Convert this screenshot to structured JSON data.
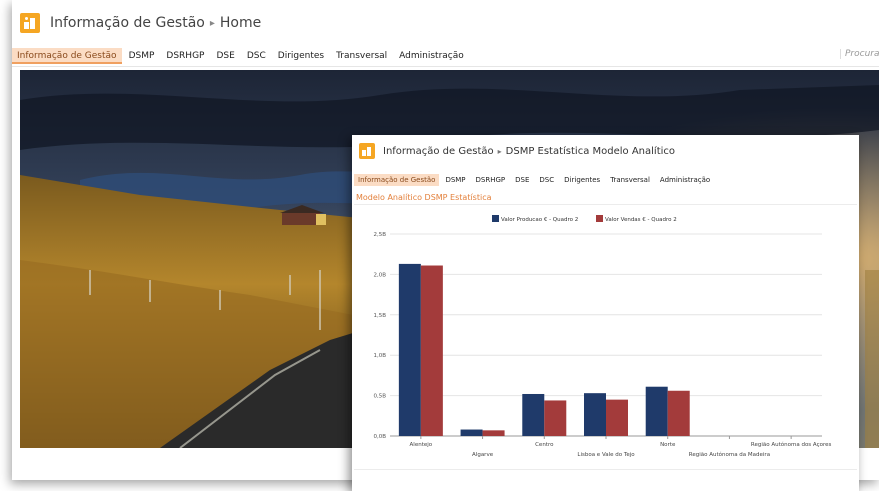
{
  "header": {
    "title": "Informação de Gestão",
    "separator": "▸",
    "page": "Home"
  },
  "nav": {
    "items": [
      {
        "label": "Informação de Gestão",
        "active": true
      },
      {
        "label": "DSMP"
      },
      {
        "label": "DSRHGP"
      },
      {
        "label": "DSE"
      },
      {
        "label": "DSC"
      },
      {
        "label": "Dirigentes"
      },
      {
        "label": "Transversal"
      },
      {
        "label": "Administração"
      }
    ],
    "search_placeholder": "Procurar"
  },
  "window": {
    "header": {
      "title": "Informação de Gestão",
      "separator": "▸",
      "page": "DSMP Estatística Modelo Analítico"
    },
    "nav": [
      {
        "label": "Informação de Gestão",
        "active": true
      },
      {
        "label": "DSMP"
      },
      {
        "label": "DSRHGP"
      },
      {
        "label": "DSE"
      },
      {
        "label": "DSC"
      },
      {
        "label": "Dirigentes"
      },
      {
        "label": "Transversal"
      },
      {
        "label": "Administração"
      }
    ],
    "subtitle": "Modelo Analítico DSMP Estatística"
  },
  "chart_data": {
    "type": "bar",
    "categories": [
      "Alentejo",
      "Algarve",
      "Centro",
      "Lisboa e Vale do Tejo",
      "Norte",
      "Região Autónoma da Madeira",
      "Região Autónoma dos Açores"
    ],
    "series": [
      {
        "name": "Valor Producao € - Quadro 2",
        "color": "#1f3a6a",
        "values": [
          2.13,
          0.08,
          0.52,
          0.53,
          0.61,
          0,
          0
        ]
      },
      {
        "name": "Valor Vendas € - Quadro 2",
        "color": "#a33b3b",
        "values": [
          2.11,
          0.07,
          0.44,
          0.45,
          0.56,
          0,
          0
        ]
      }
    ],
    "yticks": [
      "0,0B",
      "0,5B",
      "1,0B",
      "1,5B",
      "2,0B",
      "2,5B"
    ],
    "ylim": [
      0,
      2.5
    ],
    "legend": "top-center",
    "grid": true
  }
}
